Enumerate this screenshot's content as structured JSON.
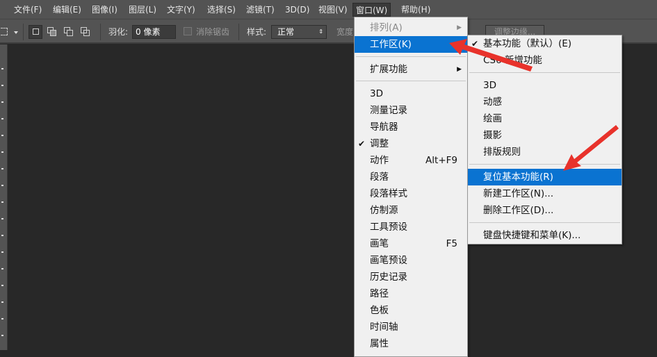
{
  "menubar": {
    "items": [
      "文件(F)",
      "编辑(E)",
      "图像(I)",
      "图层(L)",
      "文字(Y)",
      "选择(S)",
      "滤镜(T)",
      "3D(D)",
      "视图(V)",
      "窗口(W)",
      "帮助(H)"
    ]
  },
  "options": {
    "feather_label": "羽化:",
    "feather_value": "0 像素",
    "antialias_label": "消除锯齿",
    "style_label": "样式:",
    "style_value": "正常",
    "width_label": "宽度",
    "refine_edge": "调整边缘..."
  },
  "window_menu": {
    "arrange": "排列(A)",
    "workspace": "工作区(K)",
    "extensions": "扩展功能",
    "panels": [
      {
        "label": "3D"
      },
      {
        "label": "测量记录"
      },
      {
        "label": "导航器"
      },
      {
        "label": "调整",
        "checked": true
      },
      {
        "label": "动作",
        "shortcut": "Alt+F9"
      },
      {
        "label": "段落"
      },
      {
        "label": "段落样式"
      },
      {
        "label": "仿制源"
      },
      {
        "label": "工具预设"
      },
      {
        "label": "画笔",
        "shortcut": "F5"
      },
      {
        "label": "画笔预设"
      },
      {
        "label": "历史记录"
      },
      {
        "label": "路径"
      },
      {
        "label": "色板"
      },
      {
        "label": "时间轴"
      },
      {
        "label": "属性"
      }
    ]
  },
  "workspace_menu": {
    "essentials": "基本功能（默认）(E)",
    "cs6": "CS6 新增功能",
    "presets": [
      "3D",
      "动感",
      "绘画",
      "摄影",
      "排版规则"
    ],
    "reset": "复位基本功能(R)",
    "new": "新建工作区(N)...",
    "delete": "删除工作区(D)...",
    "shortcuts": "键盘快捷键和菜单(K)..."
  },
  "colors": {
    "highlight": "#0a73d1",
    "arrow": "#e8322b"
  }
}
